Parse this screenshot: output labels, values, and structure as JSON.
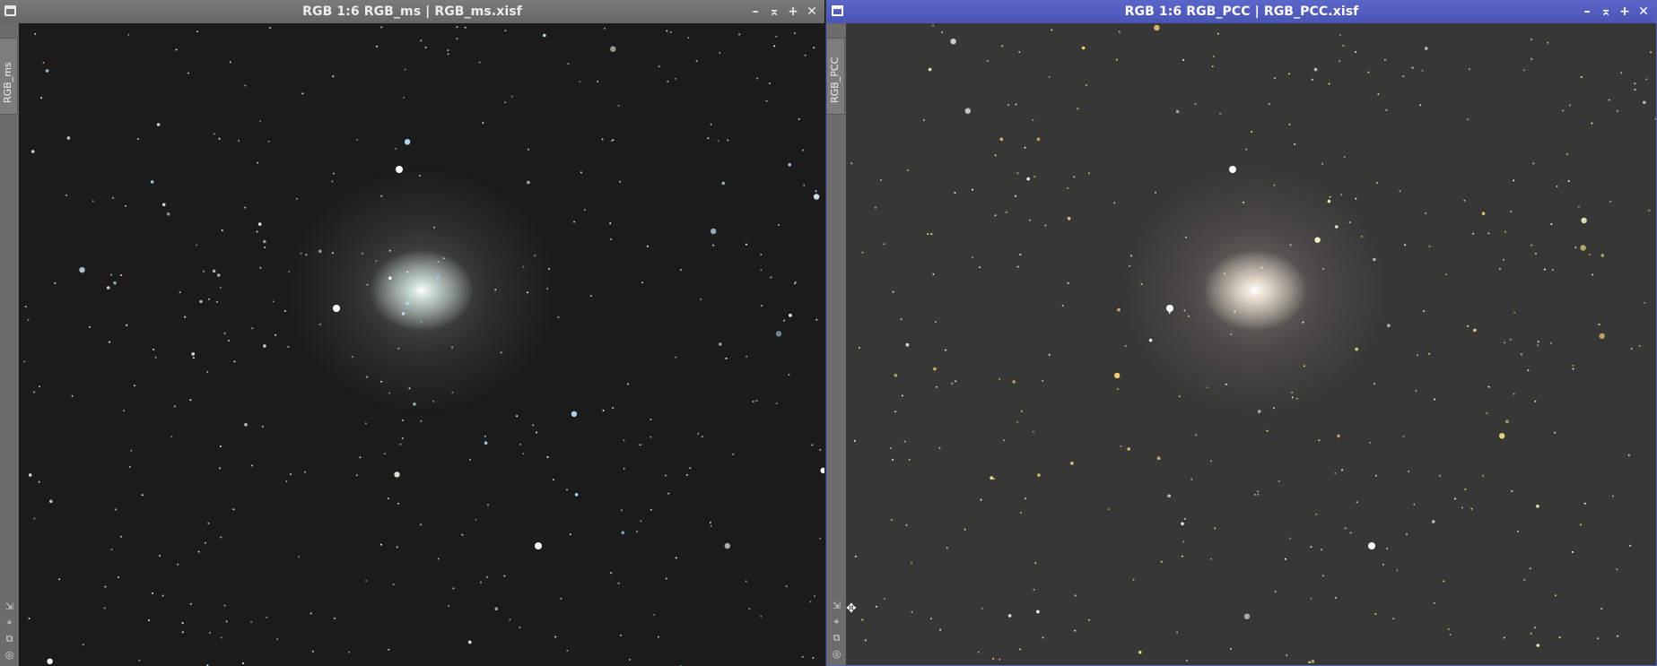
{
  "windows": [
    {
      "id": "left",
      "title": "RGB 1:6 RGB_ms | RGB_ms.xisf",
      "tab_label": "RGB_ms",
      "active": false,
      "image_background": "#1c1b1b",
      "galaxy_color": "#cfe0da",
      "star_palette": [
        "#bfe6ff",
        "#d8f0ff",
        "#ffffff",
        "#9fd2ee",
        "#e6e6d8"
      ]
    },
    {
      "id": "right",
      "title": "RGB 1:6 RGB_PCC | RGB_PCC.xisf",
      "tab_label": "RGB_PCC",
      "active": true,
      "image_background": "#373735",
      "galaxy_color": "#efe3d4",
      "star_palette": [
        "#fff5c8",
        "#ffe88a",
        "#ffffff",
        "#ffd27a",
        "#e8e4d6"
      ]
    }
  ],
  "window_controls": [
    "minimize-icon",
    "shade-icon",
    "maximize-icon",
    "close-icon"
  ],
  "sidebar_tools": [
    "zoom-fit-icon",
    "crosshair-icon",
    "clone-icon",
    "target-icon"
  ],
  "accent_color": "#4f5abd"
}
